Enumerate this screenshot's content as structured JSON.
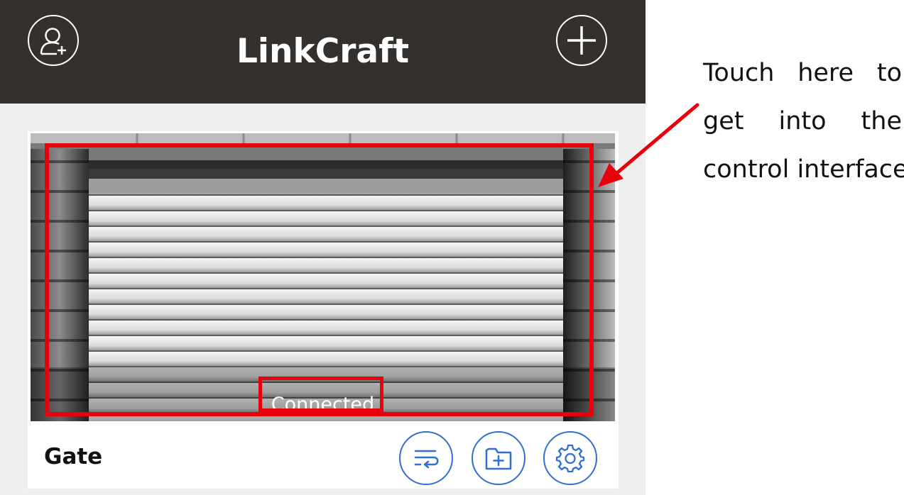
{
  "header": {
    "title": "LinkCraft",
    "add_user_icon": "person-add-icon",
    "add_device_icon": "plus-icon",
    "background": "#33302d"
  },
  "device_card": {
    "name": "Gate",
    "status": "Connected",
    "image": "roller-shutter-garage-door",
    "actions": [
      {
        "icon": "sync-list-icon"
      },
      {
        "icon": "folder-add-icon"
      },
      {
        "icon": "gear-icon"
      }
    ],
    "action_color": "#2f6fd0"
  },
  "annotation": {
    "lines": [
      "Touch here to",
      "get into the",
      "control interface"
    ],
    "highlight_color": "#e8000b"
  }
}
